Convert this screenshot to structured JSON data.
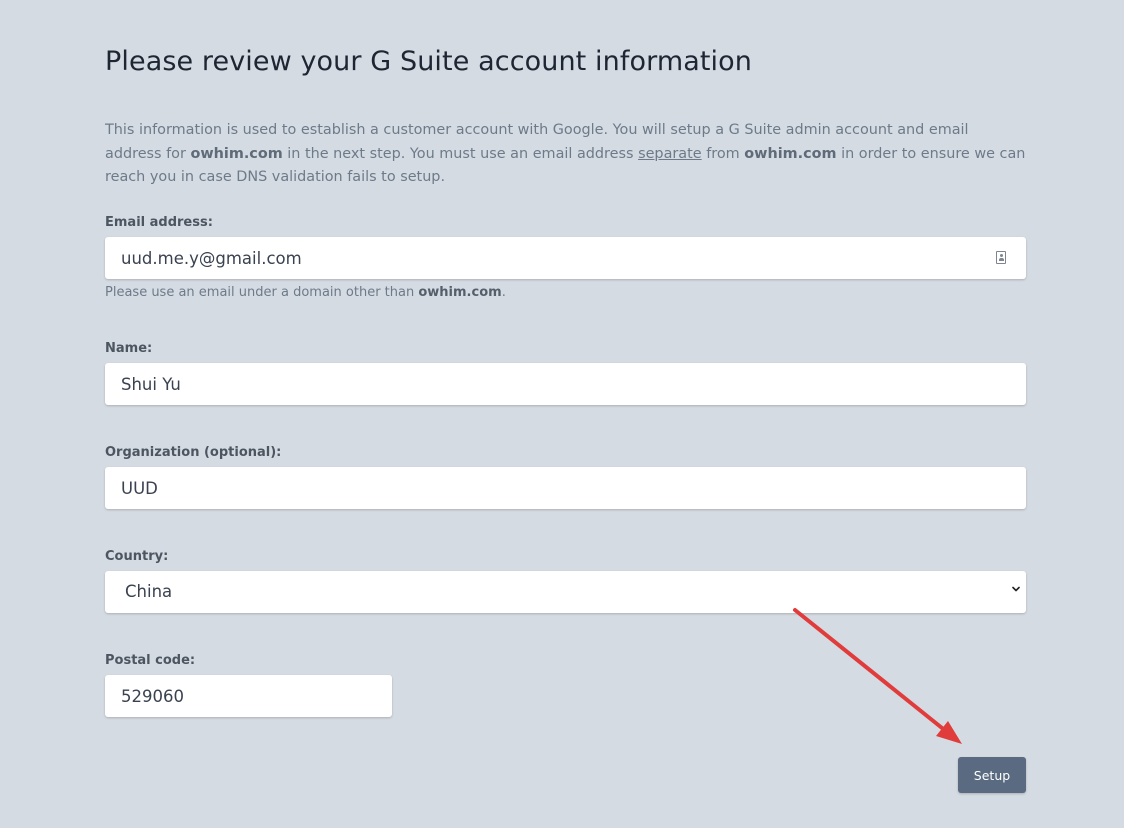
{
  "page": {
    "title": "Please review your G Suite account information"
  },
  "intro": {
    "part1": "This information is used to establish a customer account with Google. You will setup a G Suite admin account and email address for ",
    "domain1": "owhim.com",
    "part2": " in the next step. You must use an email address ",
    "separate_link": "separate",
    "part3": " from ",
    "domain2": "owhim.com",
    "part4": " in order to ensure we can reach you in case DNS validation fails to setup."
  },
  "email": {
    "label": "Email address:",
    "value": "uud.me.y@gmail.com",
    "help_prefix": "Please use an email under a domain other than ",
    "help_domain": "owhim.com",
    "help_suffix": "."
  },
  "name": {
    "label": "Name:",
    "value": "Shui Yu"
  },
  "organization": {
    "label": "Organization (optional):",
    "value": "UUD"
  },
  "country": {
    "label": "Country:",
    "selected": "China"
  },
  "postal": {
    "label": "Postal code:",
    "value": "529060"
  },
  "actions": {
    "setup_label": "Setup"
  },
  "annotation": {
    "arrow_color": "#e03c3c"
  },
  "icons": {
    "email_field_icon": "contact-card-icon",
    "select_icon": "chevron-down-icon"
  }
}
